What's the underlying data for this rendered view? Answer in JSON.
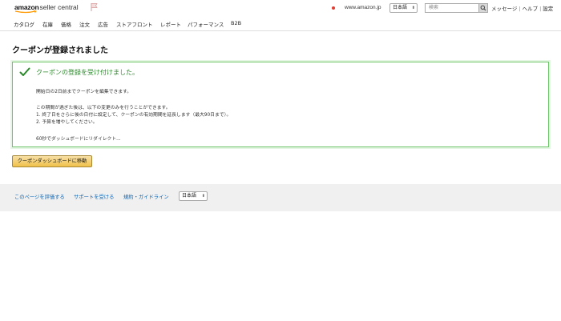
{
  "header": {
    "logo_brand": "amazon",
    "logo_product": "seller central",
    "marketplace": "www.amazon.jp",
    "language": "日本語",
    "search_placeholder": "検索",
    "links": [
      "メッセージ",
      "ヘルプ",
      "設定"
    ]
  },
  "nav": {
    "items": [
      "カタログ",
      "在庫",
      "価格",
      "注文",
      "広告",
      "ストアフロント",
      "レポート",
      "パフォーマンス",
      "B2B"
    ]
  },
  "page": {
    "title": "クーポンが登録されました",
    "alert": {
      "heading": "クーポンの登録を受け付けました。",
      "line1": "開始日の2日前までクーポンを編集できます。",
      "line2": "この期間が過ぎた後は、以下の変更のみを行うことができます。",
      "line3": "1. 終了日をさらに後の日付に設定して、クーポンの有効期間を延長します（最大90日まで）。",
      "line4": "2. 予算を増やしてください。",
      "line5": "60秒でダッシュボードにリダイレクト..."
    },
    "dashboard_button": "クーポンダッシュボードに移動"
  },
  "footer": {
    "links": [
      "このページを評価する",
      "サポートを受ける",
      "規約・ガイドライン"
    ],
    "language": "日本語"
  },
  "colors": {
    "link": "#0a66b8",
    "success": "#2a8a2a",
    "button": "#f0c14b",
    "footer_bg": "#f0f0f0"
  }
}
